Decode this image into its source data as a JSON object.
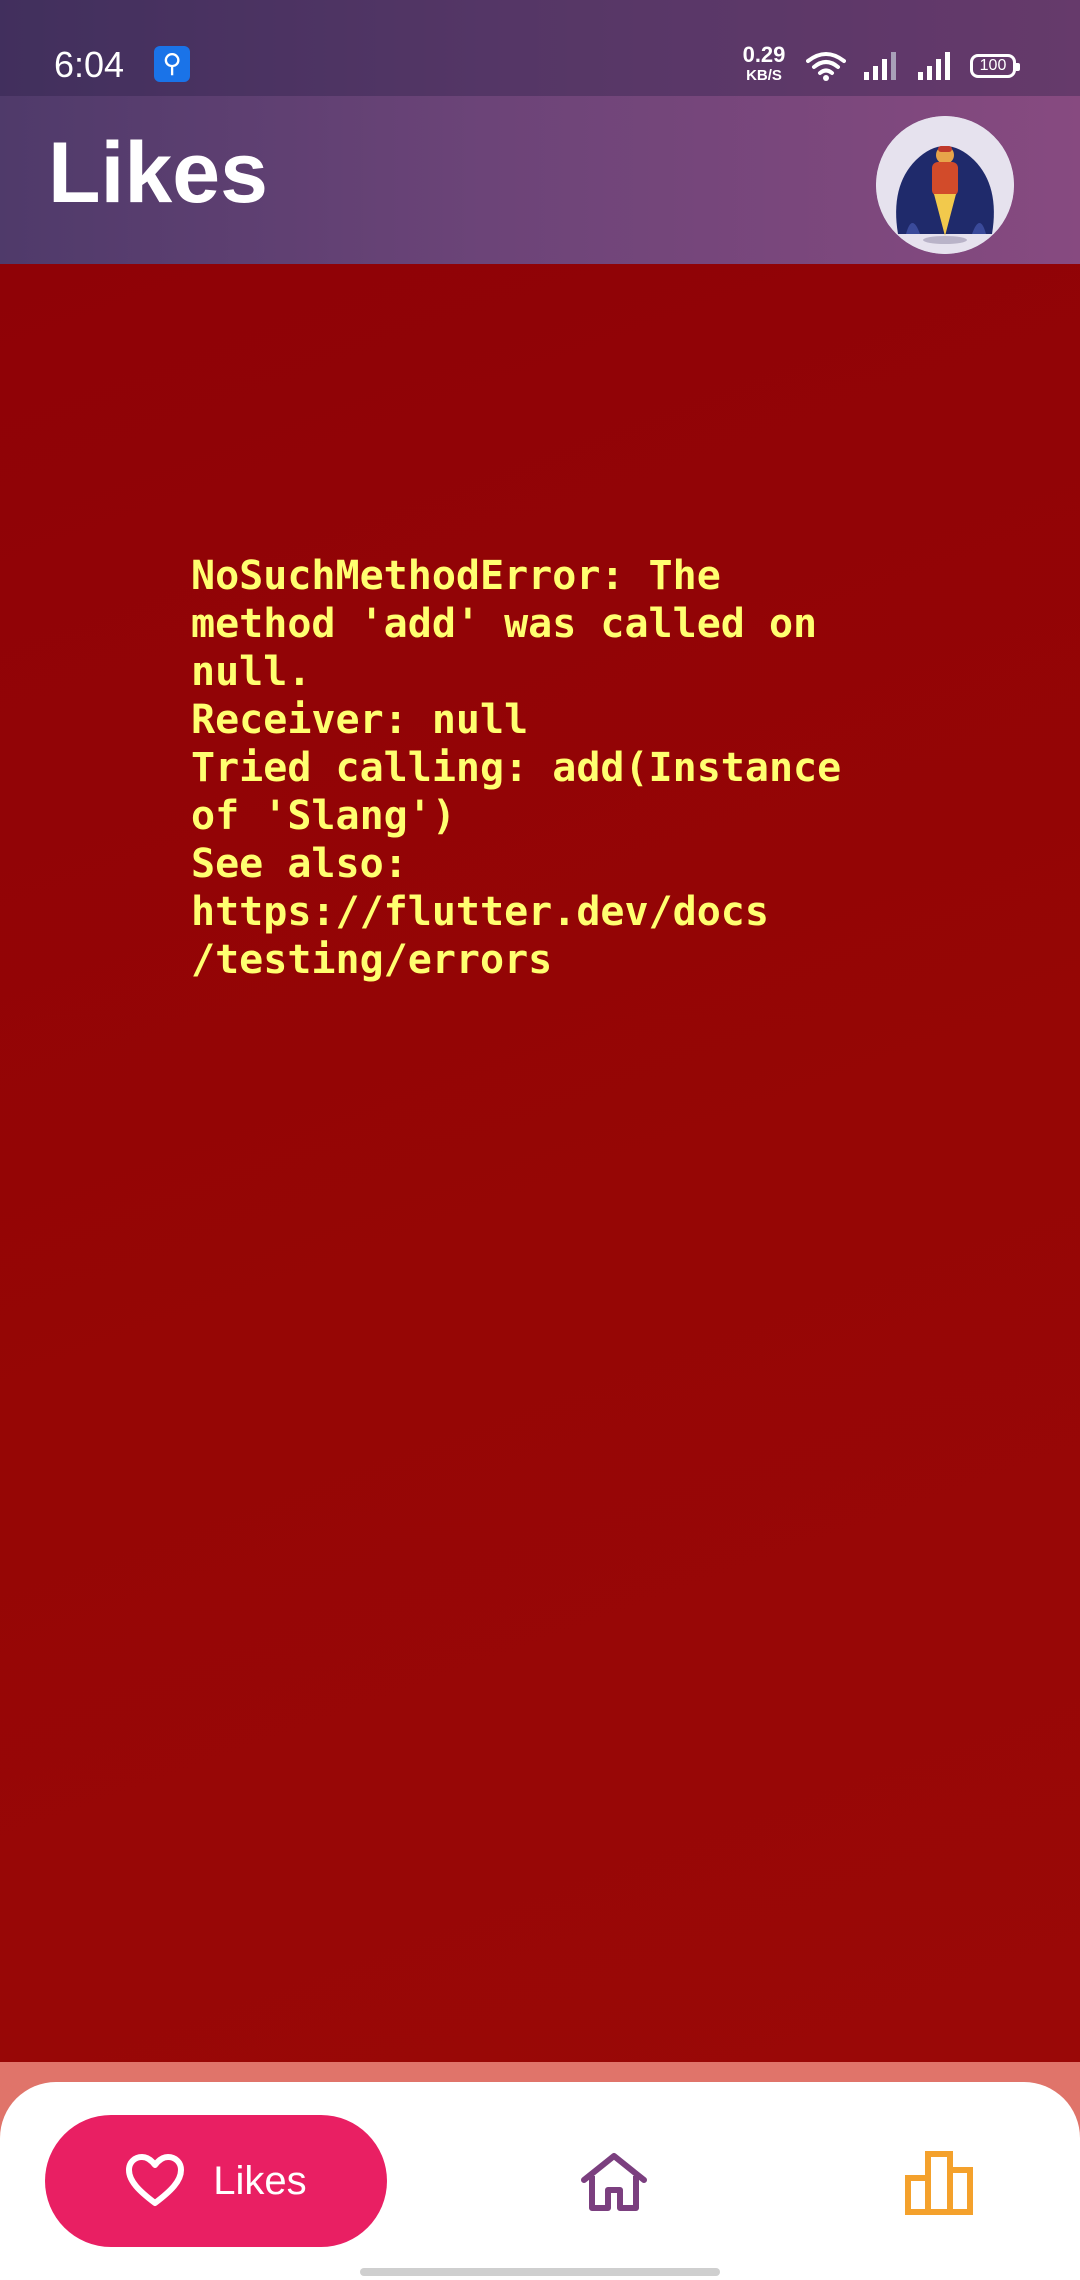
{
  "status_bar": {
    "time": "6:04",
    "net_speed_value": "0.29",
    "net_speed_unit": "KB/S",
    "battery": "100",
    "icons": [
      "usb-icon",
      "wifi-icon",
      "signal-icon",
      "signal-icon",
      "battery-icon"
    ]
  },
  "header": {
    "title": "Likes",
    "avatar_icon": "profile-avatar"
  },
  "error": {
    "message": "NoSuchMethodError: The\nmethod 'add' was called on\nnull.\nReceiver: null\nTried calling: add(Instance\nof 'Slang')\nSee also:\nhttps://flutter.dev/docs\n/testing/errors"
  },
  "bottom_nav": {
    "items": [
      {
        "label": "Likes",
        "icon": "heart-icon",
        "active": true
      },
      {
        "label": "",
        "icon": "home-icon",
        "active": false
      },
      {
        "label": "",
        "icon": "leaderboard-icon",
        "active": false
      }
    ]
  },
  "colors": {
    "header_gradient_start": "#4f3a6a",
    "header_gradient_end": "#874a80",
    "error_background": "#960404",
    "error_text": "#ffff70",
    "active_tab": "#e91f63",
    "home_icon": "#7b3f7f",
    "stats_icon": "#f4a12c"
  }
}
